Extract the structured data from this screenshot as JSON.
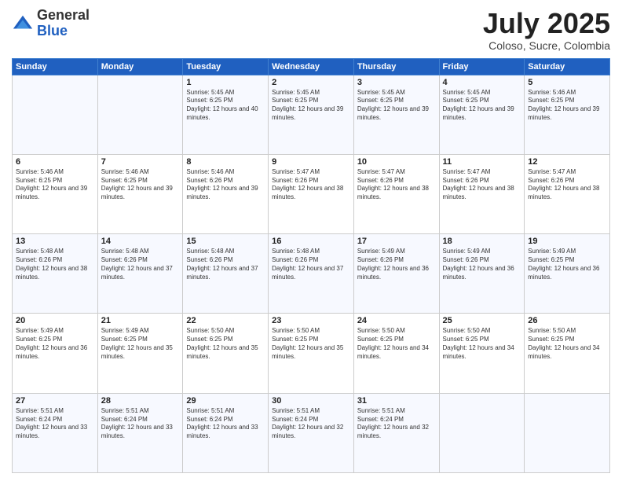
{
  "logo": {
    "general": "General",
    "blue": "Blue"
  },
  "header": {
    "month": "July 2025",
    "location": "Coloso, Sucre, Colombia"
  },
  "days_of_week": [
    "Sunday",
    "Monday",
    "Tuesday",
    "Wednesday",
    "Thursday",
    "Friday",
    "Saturday"
  ],
  "weeks": [
    [
      {
        "day": "",
        "info": ""
      },
      {
        "day": "",
        "info": ""
      },
      {
        "day": "1",
        "info": "Sunrise: 5:45 AM\nSunset: 6:25 PM\nDaylight: 12 hours and 40 minutes."
      },
      {
        "day": "2",
        "info": "Sunrise: 5:45 AM\nSunset: 6:25 PM\nDaylight: 12 hours and 39 minutes."
      },
      {
        "day": "3",
        "info": "Sunrise: 5:45 AM\nSunset: 6:25 PM\nDaylight: 12 hours and 39 minutes."
      },
      {
        "day": "4",
        "info": "Sunrise: 5:45 AM\nSunset: 6:25 PM\nDaylight: 12 hours and 39 minutes."
      },
      {
        "day": "5",
        "info": "Sunrise: 5:46 AM\nSunset: 6:25 PM\nDaylight: 12 hours and 39 minutes."
      }
    ],
    [
      {
        "day": "6",
        "info": "Sunrise: 5:46 AM\nSunset: 6:25 PM\nDaylight: 12 hours and 39 minutes."
      },
      {
        "day": "7",
        "info": "Sunrise: 5:46 AM\nSunset: 6:25 PM\nDaylight: 12 hours and 39 minutes."
      },
      {
        "day": "8",
        "info": "Sunrise: 5:46 AM\nSunset: 6:26 PM\nDaylight: 12 hours and 39 minutes."
      },
      {
        "day": "9",
        "info": "Sunrise: 5:47 AM\nSunset: 6:26 PM\nDaylight: 12 hours and 38 minutes."
      },
      {
        "day": "10",
        "info": "Sunrise: 5:47 AM\nSunset: 6:26 PM\nDaylight: 12 hours and 38 minutes."
      },
      {
        "day": "11",
        "info": "Sunrise: 5:47 AM\nSunset: 6:26 PM\nDaylight: 12 hours and 38 minutes."
      },
      {
        "day": "12",
        "info": "Sunrise: 5:47 AM\nSunset: 6:26 PM\nDaylight: 12 hours and 38 minutes."
      }
    ],
    [
      {
        "day": "13",
        "info": "Sunrise: 5:48 AM\nSunset: 6:26 PM\nDaylight: 12 hours and 38 minutes."
      },
      {
        "day": "14",
        "info": "Sunrise: 5:48 AM\nSunset: 6:26 PM\nDaylight: 12 hours and 37 minutes."
      },
      {
        "day": "15",
        "info": "Sunrise: 5:48 AM\nSunset: 6:26 PM\nDaylight: 12 hours and 37 minutes."
      },
      {
        "day": "16",
        "info": "Sunrise: 5:48 AM\nSunset: 6:26 PM\nDaylight: 12 hours and 37 minutes."
      },
      {
        "day": "17",
        "info": "Sunrise: 5:49 AM\nSunset: 6:26 PM\nDaylight: 12 hours and 36 minutes."
      },
      {
        "day": "18",
        "info": "Sunrise: 5:49 AM\nSunset: 6:26 PM\nDaylight: 12 hours and 36 minutes."
      },
      {
        "day": "19",
        "info": "Sunrise: 5:49 AM\nSunset: 6:25 PM\nDaylight: 12 hours and 36 minutes."
      }
    ],
    [
      {
        "day": "20",
        "info": "Sunrise: 5:49 AM\nSunset: 6:25 PM\nDaylight: 12 hours and 36 minutes."
      },
      {
        "day": "21",
        "info": "Sunrise: 5:49 AM\nSunset: 6:25 PM\nDaylight: 12 hours and 35 minutes."
      },
      {
        "day": "22",
        "info": "Sunrise: 5:50 AM\nSunset: 6:25 PM\nDaylight: 12 hours and 35 minutes."
      },
      {
        "day": "23",
        "info": "Sunrise: 5:50 AM\nSunset: 6:25 PM\nDaylight: 12 hours and 35 minutes."
      },
      {
        "day": "24",
        "info": "Sunrise: 5:50 AM\nSunset: 6:25 PM\nDaylight: 12 hours and 34 minutes."
      },
      {
        "day": "25",
        "info": "Sunrise: 5:50 AM\nSunset: 6:25 PM\nDaylight: 12 hours and 34 minutes."
      },
      {
        "day": "26",
        "info": "Sunrise: 5:50 AM\nSunset: 6:25 PM\nDaylight: 12 hours and 34 minutes."
      }
    ],
    [
      {
        "day": "27",
        "info": "Sunrise: 5:51 AM\nSunset: 6:24 PM\nDaylight: 12 hours and 33 minutes."
      },
      {
        "day": "28",
        "info": "Sunrise: 5:51 AM\nSunset: 6:24 PM\nDaylight: 12 hours and 33 minutes."
      },
      {
        "day": "29",
        "info": "Sunrise: 5:51 AM\nSunset: 6:24 PM\nDaylight: 12 hours and 33 minutes."
      },
      {
        "day": "30",
        "info": "Sunrise: 5:51 AM\nSunset: 6:24 PM\nDaylight: 12 hours and 32 minutes."
      },
      {
        "day": "31",
        "info": "Sunrise: 5:51 AM\nSunset: 6:24 PM\nDaylight: 12 hours and 32 minutes."
      },
      {
        "day": "",
        "info": ""
      },
      {
        "day": "",
        "info": ""
      }
    ]
  ]
}
